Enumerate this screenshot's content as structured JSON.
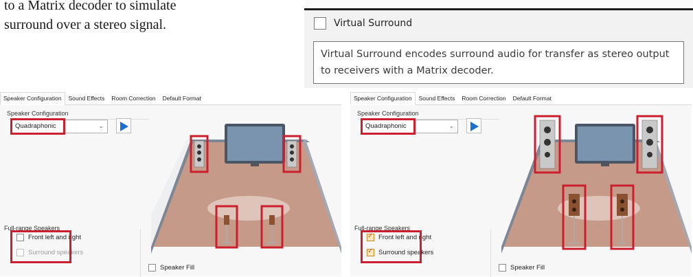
{
  "caption": {
    "line1": "to a Matrix decoder to simulate",
    "line2": "surround over a stereo signal."
  },
  "inset": {
    "checkbox_label": "Virtual Surround",
    "tooltip": "Virtual Surround encodes surround audio for transfer as stereo output to receivers with a Matrix decoder."
  },
  "panels": [
    {
      "tabs": [
        "Speaker Configuration",
        "Sound Effects",
        "Room Correction",
        "Default Format"
      ],
      "group_title": "Speaker Configuration",
      "select_value": "Quadraphonic",
      "fullrange_title": "Full-range Speakers",
      "front_label": "Front left and right",
      "front_checked": false,
      "surround_label": "Surround speakers",
      "surround_checked": false,
      "speaker_fill_label": "Speaker Fill"
    },
    {
      "tabs": [
        "Speaker Configuration",
        "Sound Effects",
        "Room Correction",
        "Default Format"
      ],
      "group_title": "Speaker Configuration",
      "select_value": "Quadraphonic",
      "fullrange_title": "Full-range Speakers",
      "front_label": "Front left and right",
      "front_checked": true,
      "surround_label": "Surround speakers",
      "surround_checked": true,
      "speaker_fill_label": "Speaker Fill"
    }
  ],
  "colors": {
    "highlight": "#cc1f2d",
    "floor": "#c59a88",
    "play": "#1f6fd0"
  }
}
